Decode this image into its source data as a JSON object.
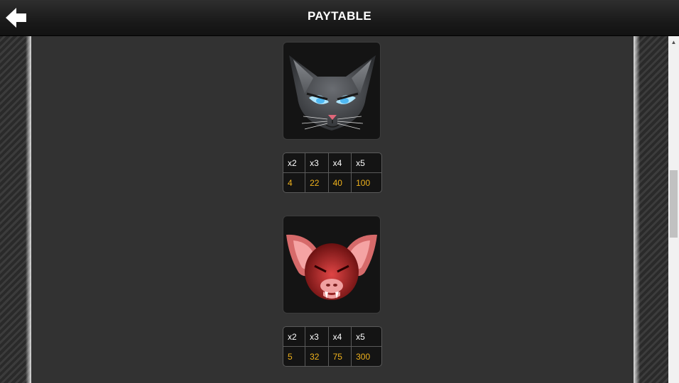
{
  "header": {
    "title": "PAYTABLE",
    "back_icon": "arrow-left-icon"
  },
  "symbols": [
    {
      "icon": "cat-head-icon",
      "multipliers": [
        "x2",
        "x3",
        "x4",
        "x5"
      ],
      "payouts": [
        "4",
        "22",
        "40",
        "100"
      ]
    },
    {
      "icon": "bat-head-icon",
      "multipliers": [
        "x2",
        "x3",
        "x4",
        "x5"
      ],
      "payouts": [
        "5",
        "32",
        "75",
        "300"
      ]
    }
  ],
  "colors": {
    "payout": "#f0b21c",
    "header_text": "#ffffff",
    "panel": "#323232"
  }
}
